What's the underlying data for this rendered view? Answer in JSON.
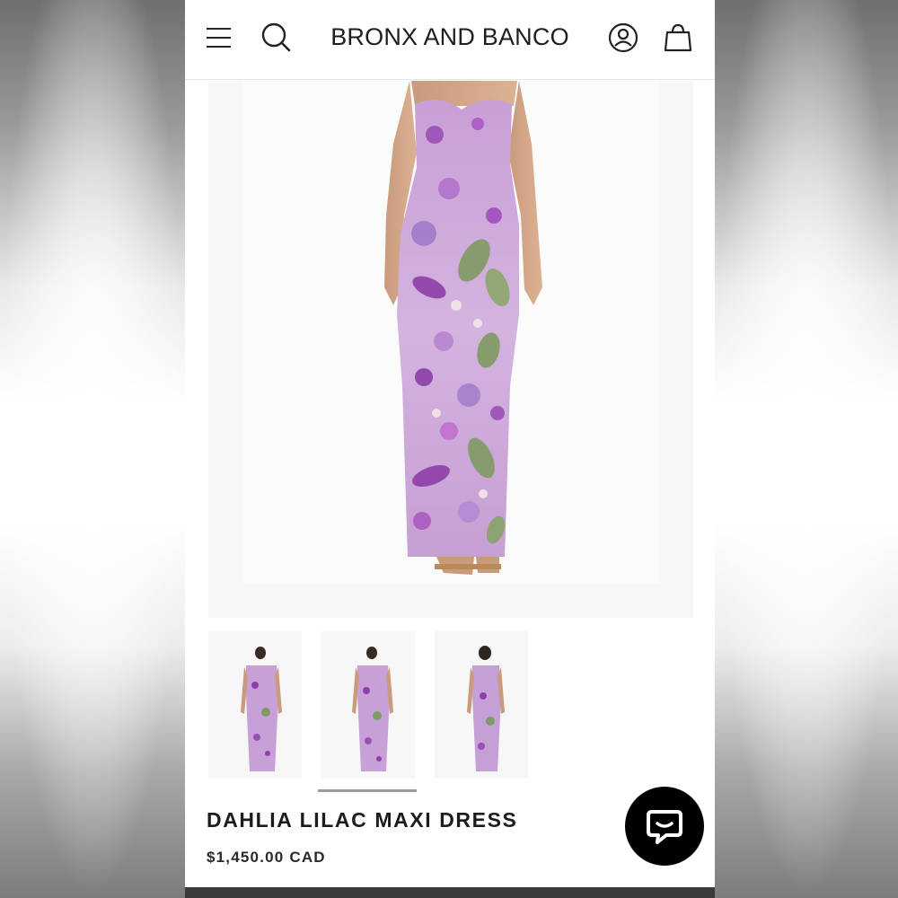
{
  "header": {
    "brand": "BRONX AND BANCO",
    "icons": [
      "menu-icon",
      "search-icon",
      "account-icon",
      "shopping-bag-icon"
    ]
  },
  "product": {
    "title": "DAHLIA LILAC MAXI DRESS",
    "price": "$1,450.00 CAD"
  },
  "gallery": {
    "thumbnail_count": 3,
    "active_thumbnail": 2
  },
  "chat": {
    "icon": "chat-bubble-icon"
  },
  "colors": {
    "background": "#ffffff",
    "text": "#1c1c1c",
    "chat_button": "#000000",
    "dress_lilac": "#c7a0da",
    "dress_purple": "#8e3fa8",
    "leaf_green": "#7f9a63"
  }
}
